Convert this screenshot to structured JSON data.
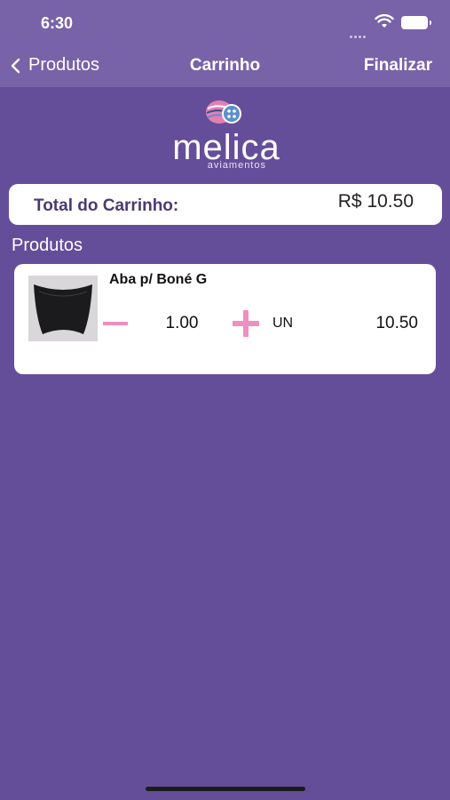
{
  "status_bar": {
    "time": "6:30",
    "icons": [
      "signal-dots-icon",
      "wifi-icon",
      "battery-icon"
    ]
  },
  "navbar": {
    "back_label": "Produtos",
    "back_icon": "chevron-left-icon",
    "title": "Carrinho",
    "action_label": "Finalizar"
  },
  "logo": {
    "name": "melica",
    "subtitle": "aviamentos",
    "colors": {
      "pink": "#e57fb2",
      "blue": "#5d8fc9",
      "navy": "#2f4f8a"
    }
  },
  "cart": {
    "total_label": "Total do Carrinho:",
    "total_value": "R$ 10.50"
  },
  "products_section": {
    "title": "Produtos",
    "items": [
      {
        "name": "Aba p/ Boné G",
        "quantity": "1.00",
        "unit": "UN",
        "price": "10.50",
        "image": "visor-product-image"
      }
    ]
  },
  "colors": {
    "background": "#654e99",
    "bar": "#7862a8",
    "card": "#ffffff",
    "accent_pink": "#ef8fc0",
    "total_label": "#4a3a70"
  }
}
